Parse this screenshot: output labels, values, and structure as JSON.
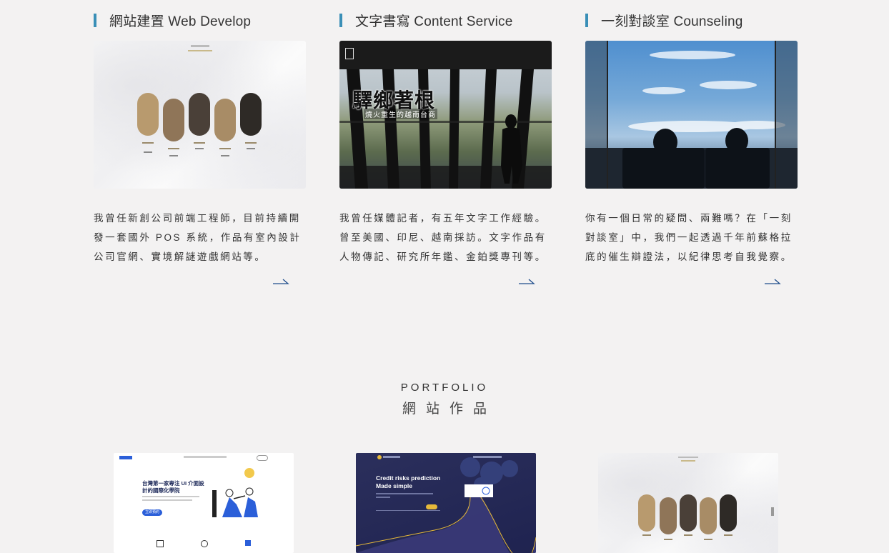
{
  "services": [
    {
      "title": "網站建置 Web Develop",
      "description": "我曾任新創公司前端工程師，目前持續開發一套國外 POS 系統，作品有室內設計公司官網、實境解謎遊戲網站等。",
      "image_caption": ""
    },
    {
      "title": "文字書寫 Content Service",
      "description": "我曾任媒體記者，有五年文字工作經驗。曾至美國、印尼、越南採訪。文字作品有人物傳記、研究所年鑑、金鉑獎專刊等。",
      "image_overlay_title": "驛鄉著根",
      "image_overlay_subtitle": "燒火重生的越南台商"
    },
    {
      "title": "一刻對談室 Counseling",
      "description": "你有一個日常的疑問、兩難嗎？在「一刻對談室」中，我們一起透過千年前蘇格拉底的催生辯證法，以紀律思考自我覺察。"
    }
  ],
  "portfolio": {
    "title_en": "PORTFOLIO",
    "title_zh": "網站作品",
    "items": [
      {
        "headline": "台灣第一家專注 UI 介面設計的國際化學院",
        "cta": "立即預約"
      },
      {
        "headline": "Credit risks prediction Made simple"
      },
      {
        "headline": ""
      }
    ]
  },
  "colors": {
    "accent": "#3a8fb7",
    "background": "#f3f2f2",
    "arrow": "#1f4e8c"
  }
}
